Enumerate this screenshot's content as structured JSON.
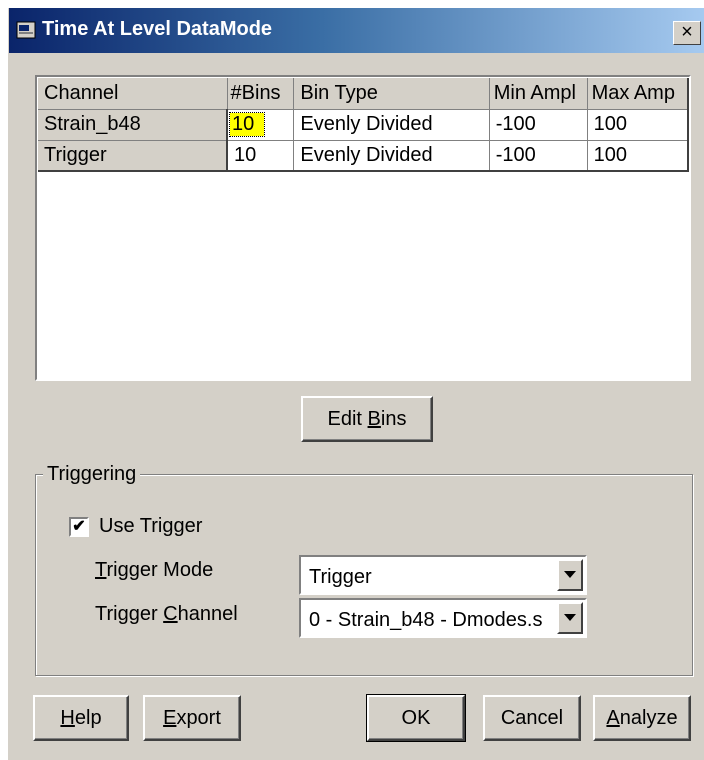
{
  "window": {
    "title": "Time At Level DataMode",
    "close_label": "×"
  },
  "grid": {
    "headers": [
      "Channel",
      "#Bins",
      "Bin Type",
      "Min Ampl",
      "Max Amp"
    ],
    "rows": [
      [
        "Strain_b48",
        "10",
        "Evenly Divided",
        "-100",
        "100"
      ],
      [
        "Trigger",
        "10",
        "Evenly Divided",
        "-100",
        "100"
      ]
    ]
  },
  "edit_bins": {
    "pre": "Edit ",
    "accel": "B",
    "post": "ins"
  },
  "triggering": {
    "legend": "Triggering",
    "use_trigger": {
      "label": "Use Trigger",
      "checked": true
    },
    "trigger_mode": {
      "accel": "T",
      "rest": "rigger Mode",
      "value": "Trigger"
    },
    "trigger_channel": {
      "pre": "Trigger ",
      "accel": "C",
      "rest": "hannel",
      "value": "0 - Strain_b48 - Dmodes.s"
    }
  },
  "buttons": {
    "help": {
      "accel": "H",
      "rest": "elp"
    },
    "export": {
      "accel": "E",
      "rest": "xport"
    },
    "ok": "OK",
    "cancel": "Cancel",
    "analyze": {
      "accel": "A",
      "rest": "nalyze"
    }
  },
  "colors": {
    "title_start": "#0a246a",
    "title_end": "#a6caf0",
    "face": "#d4d0c8",
    "selected_cell": "#ffff00"
  }
}
